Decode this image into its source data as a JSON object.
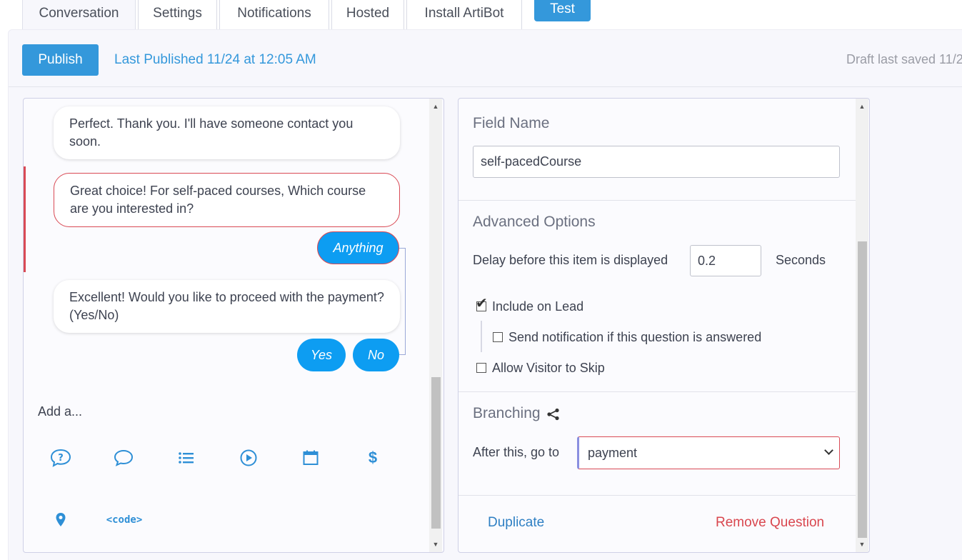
{
  "tabs": [
    {
      "label": "Conversation",
      "active": true
    },
    {
      "label": "Settings",
      "active": false
    },
    {
      "label": "Notifications",
      "active": false
    },
    {
      "label": "Hosted",
      "active": false
    },
    {
      "label": "Install ArtiBot",
      "active": false
    }
  ],
  "test_button": "Test",
  "topbar": {
    "publish_label": "Publish",
    "last_published": "Last Published 11/24 at 12:05 AM",
    "draft_saved": "Draft last saved 11/2"
  },
  "conversation": {
    "messages": [
      {
        "text": "Perfect. Thank you. I'll have someone contact you soon.",
        "selected": false
      },
      {
        "text": "Great choice! For self-paced courses, Which course are you interested in?",
        "selected": true
      },
      {
        "text": "Excellent! Would you like to proceed with the payment? (Yes/No)",
        "selected": false
      }
    ],
    "answers": {
      "anything": "Anything",
      "yes": "Yes",
      "no": "No"
    },
    "add_label": "Add a...",
    "add_icons": [
      "question-icon",
      "speech-bubble-icon",
      "list-icon",
      "play-icon",
      "calendar-icon",
      "dollar-icon",
      "location-pin-icon"
    ],
    "code_label": "<code>"
  },
  "settings": {
    "field_name_title": "Field Name",
    "field_name_value": "self-pacedCourse",
    "advanced_title": "Advanced Options",
    "delay_label": "Delay before this item is displayed",
    "delay_value": "0.2",
    "delay_unit": "Seconds",
    "include_on_lead": {
      "label": "Include on Lead",
      "checked": true
    },
    "send_notification": {
      "label": "Send notification if this question is answered",
      "checked": false
    },
    "allow_skip": {
      "label": "Allow Visitor to Skip",
      "checked": false
    },
    "branching_title": "Branching",
    "after_label": "After this, go to",
    "after_value": "payment",
    "duplicate_label": "Duplicate",
    "remove_label": "Remove Question"
  },
  "colors": {
    "accent": "#3498db",
    "answer_bubble": "#0d9df2",
    "selected_border": "#d94a55",
    "remove_red": "#d9464e"
  }
}
